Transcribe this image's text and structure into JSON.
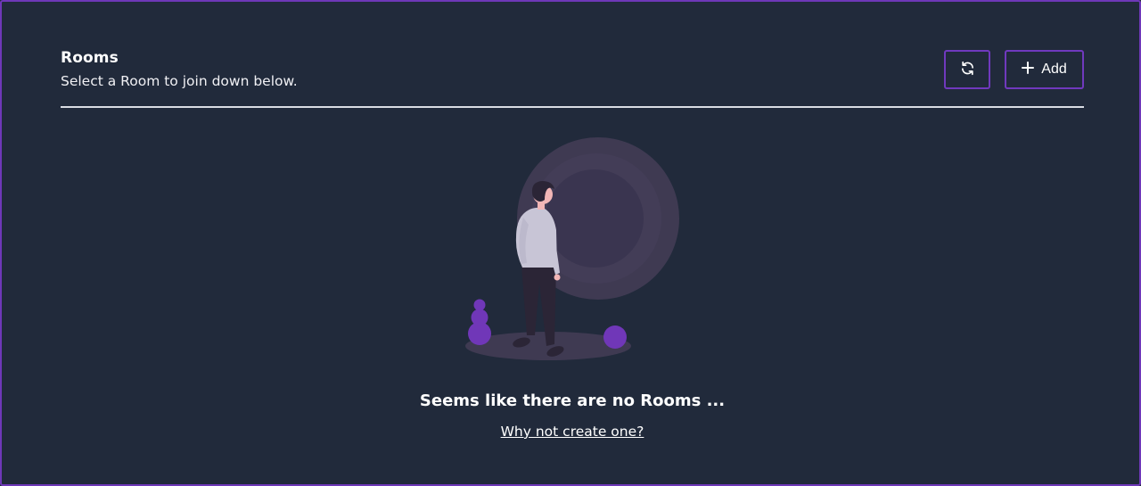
{
  "header": {
    "title": "Rooms",
    "subtitle": "Select a Room to join down below."
  },
  "toolbar": {
    "refresh_icon": "refresh-icon",
    "add_icon": "plus-icon",
    "add_label": "Add"
  },
  "empty_state": {
    "message": "Seems like there are no Rooms ...",
    "link_text": "Why not create one?"
  },
  "colors": {
    "background": "#212a3b",
    "accent": "#6e38b8",
    "divider": "#d9dce3"
  }
}
